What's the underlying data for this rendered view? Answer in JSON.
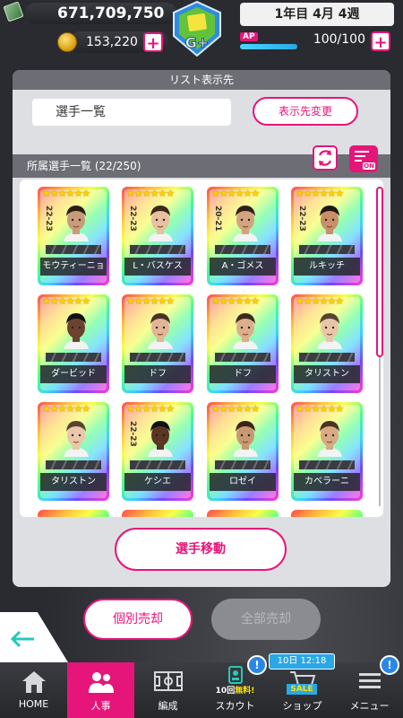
{
  "header": {
    "money": "671,709,750",
    "coins": "153,220",
    "date": "1年目 4月 4週",
    "ap_label": "AP",
    "ap_value": "100/100",
    "ap_fraction": 1.0,
    "plus_label": "+",
    "rank_label": "G+"
  },
  "list_dest": {
    "section_title": "リスト表示先",
    "current": "選手一覧",
    "change_button": "表示先変更"
  },
  "roster": {
    "section_title": "所属選手一覧 (22/250)",
    "filter_badge": "ON",
    "players": [
      {
        "name": "モウティーニョ",
        "season": "22-23",
        "stars": "★★★★★★"
      },
      {
        "name": "L・バスケス",
        "season": "22-23",
        "stars": "★★★★★★"
      },
      {
        "name": "A・ゴメス",
        "season": "20-21",
        "stars": "★★★★★★"
      },
      {
        "name": "ルキッチ",
        "season": "22-23",
        "stars": "★★★★★★"
      },
      {
        "name": "ダービッド",
        "season": "",
        "stars": "★★★★★★"
      },
      {
        "name": "ドフ",
        "season": "",
        "stars": "★★★★★★"
      },
      {
        "name": "ドフ",
        "season": "",
        "stars": "★★★★★★"
      },
      {
        "name": "タリストン",
        "season": "",
        "stars": "★★★★★★"
      },
      {
        "name": "タリストン",
        "season": "",
        "stars": "★★★★★★"
      },
      {
        "name": "ケシエ",
        "season": "22-23",
        "stars": "★★★★★★"
      },
      {
        "name": "ロゼイ",
        "season": "",
        "stars": "★★★★★★"
      },
      {
        "name": "カベラーニ",
        "season": "",
        "stars": "★★★★★★"
      }
    ],
    "move_button": "選手移動"
  },
  "actions": {
    "sell_single": "個別売却",
    "sell_all": "全部売却"
  },
  "nav": {
    "items": [
      {
        "label": "HOME",
        "icon": "home-icon"
      },
      {
        "label": "人事",
        "icon": "people-icon"
      },
      {
        "label": "編成",
        "icon": "pitch-icon"
      },
      {
        "label": "スカウト",
        "icon": "scout-icon",
        "promo_count": "10回",
        "promo_text": "無料!"
      },
      {
        "label": "ショップ",
        "icon": "shop-icon",
        "sale": "SALE"
      },
      {
        "label": "メニュー",
        "icon": "menu-icon"
      }
    ],
    "timer": "10日 12:18",
    "notify_mark": "!"
  },
  "colors": {
    "accent": "#e6157a",
    "ap_bar": "#2aa7e6",
    "panel": "#dedfe3"
  }
}
